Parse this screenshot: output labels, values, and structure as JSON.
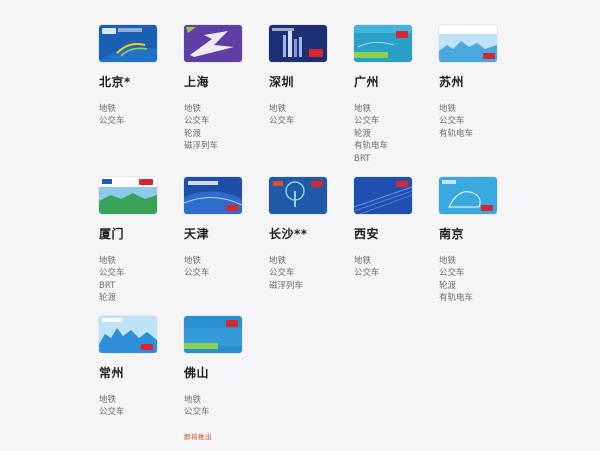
{
  "cities": [
    {
      "name": "北京*",
      "modes": [
        "地铁",
        "公交车"
      ],
      "card": "beijing"
    },
    {
      "name": "上海",
      "modes": [
        "地铁",
        "公交车",
        "轮渡",
        "磁浮列车"
      ],
      "card": "shanghai"
    },
    {
      "name": "深圳",
      "modes": [
        "地铁",
        "公交车"
      ],
      "card": "shenzhen"
    },
    {
      "name": "广州",
      "modes": [
        "地铁",
        "公交车",
        "轮渡",
        "有轨电车",
        "BRT"
      ],
      "card": "guangzhou"
    },
    {
      "name": "苏州",
      "modes": [
        "地铁",
        "公交车",
        "有轨电车"
      ],
      "card": "suzhou"
    },
    {
      "name": "厦门",
      "modes": [
        "地铁",
        "公交车",
        "BRT",
        "轮渡"
      ],
      "card": "xiamen"
    },
    {
      "name": "天津",
      "modes": [
        "地铁",
        "公交车"
      ],
      "card": "tianjin"
    },
    {
      "name": "长沙**",
      "modes": [
        "地铁",
        "公交车",
        "磁浮列车"
      ],
      "card": "changsha"
    },
    {
      "name": "西安",
      "modes": [
        "地铁",
        "公交车"
      ],
      "card": "xian"
    },
    {
      "name": "南京",
      "modes": [
        "地铁",
        "公交车",
        "轮渡",
        "有轨电车"
      ],
      "card": "nanjing"
    },
    {
      "name": "常州",
      "modes": [
        "地铁",
        "公交车"
      ],
      "card": "changzhou"
    },
    {
      "name": "佛山",
      "modes": [
        "地铁",
        "公交车"
      ],
      "card": "foshan"
    }
  ],
  "coming_soon": "即将推出",
  "colors": {
    "text_primary": "#1d1d1f",
    "text_secondary": "#6e6e73",
    "accent": "#d2481e",
    "background": "#f5f5f7"
  }
}
